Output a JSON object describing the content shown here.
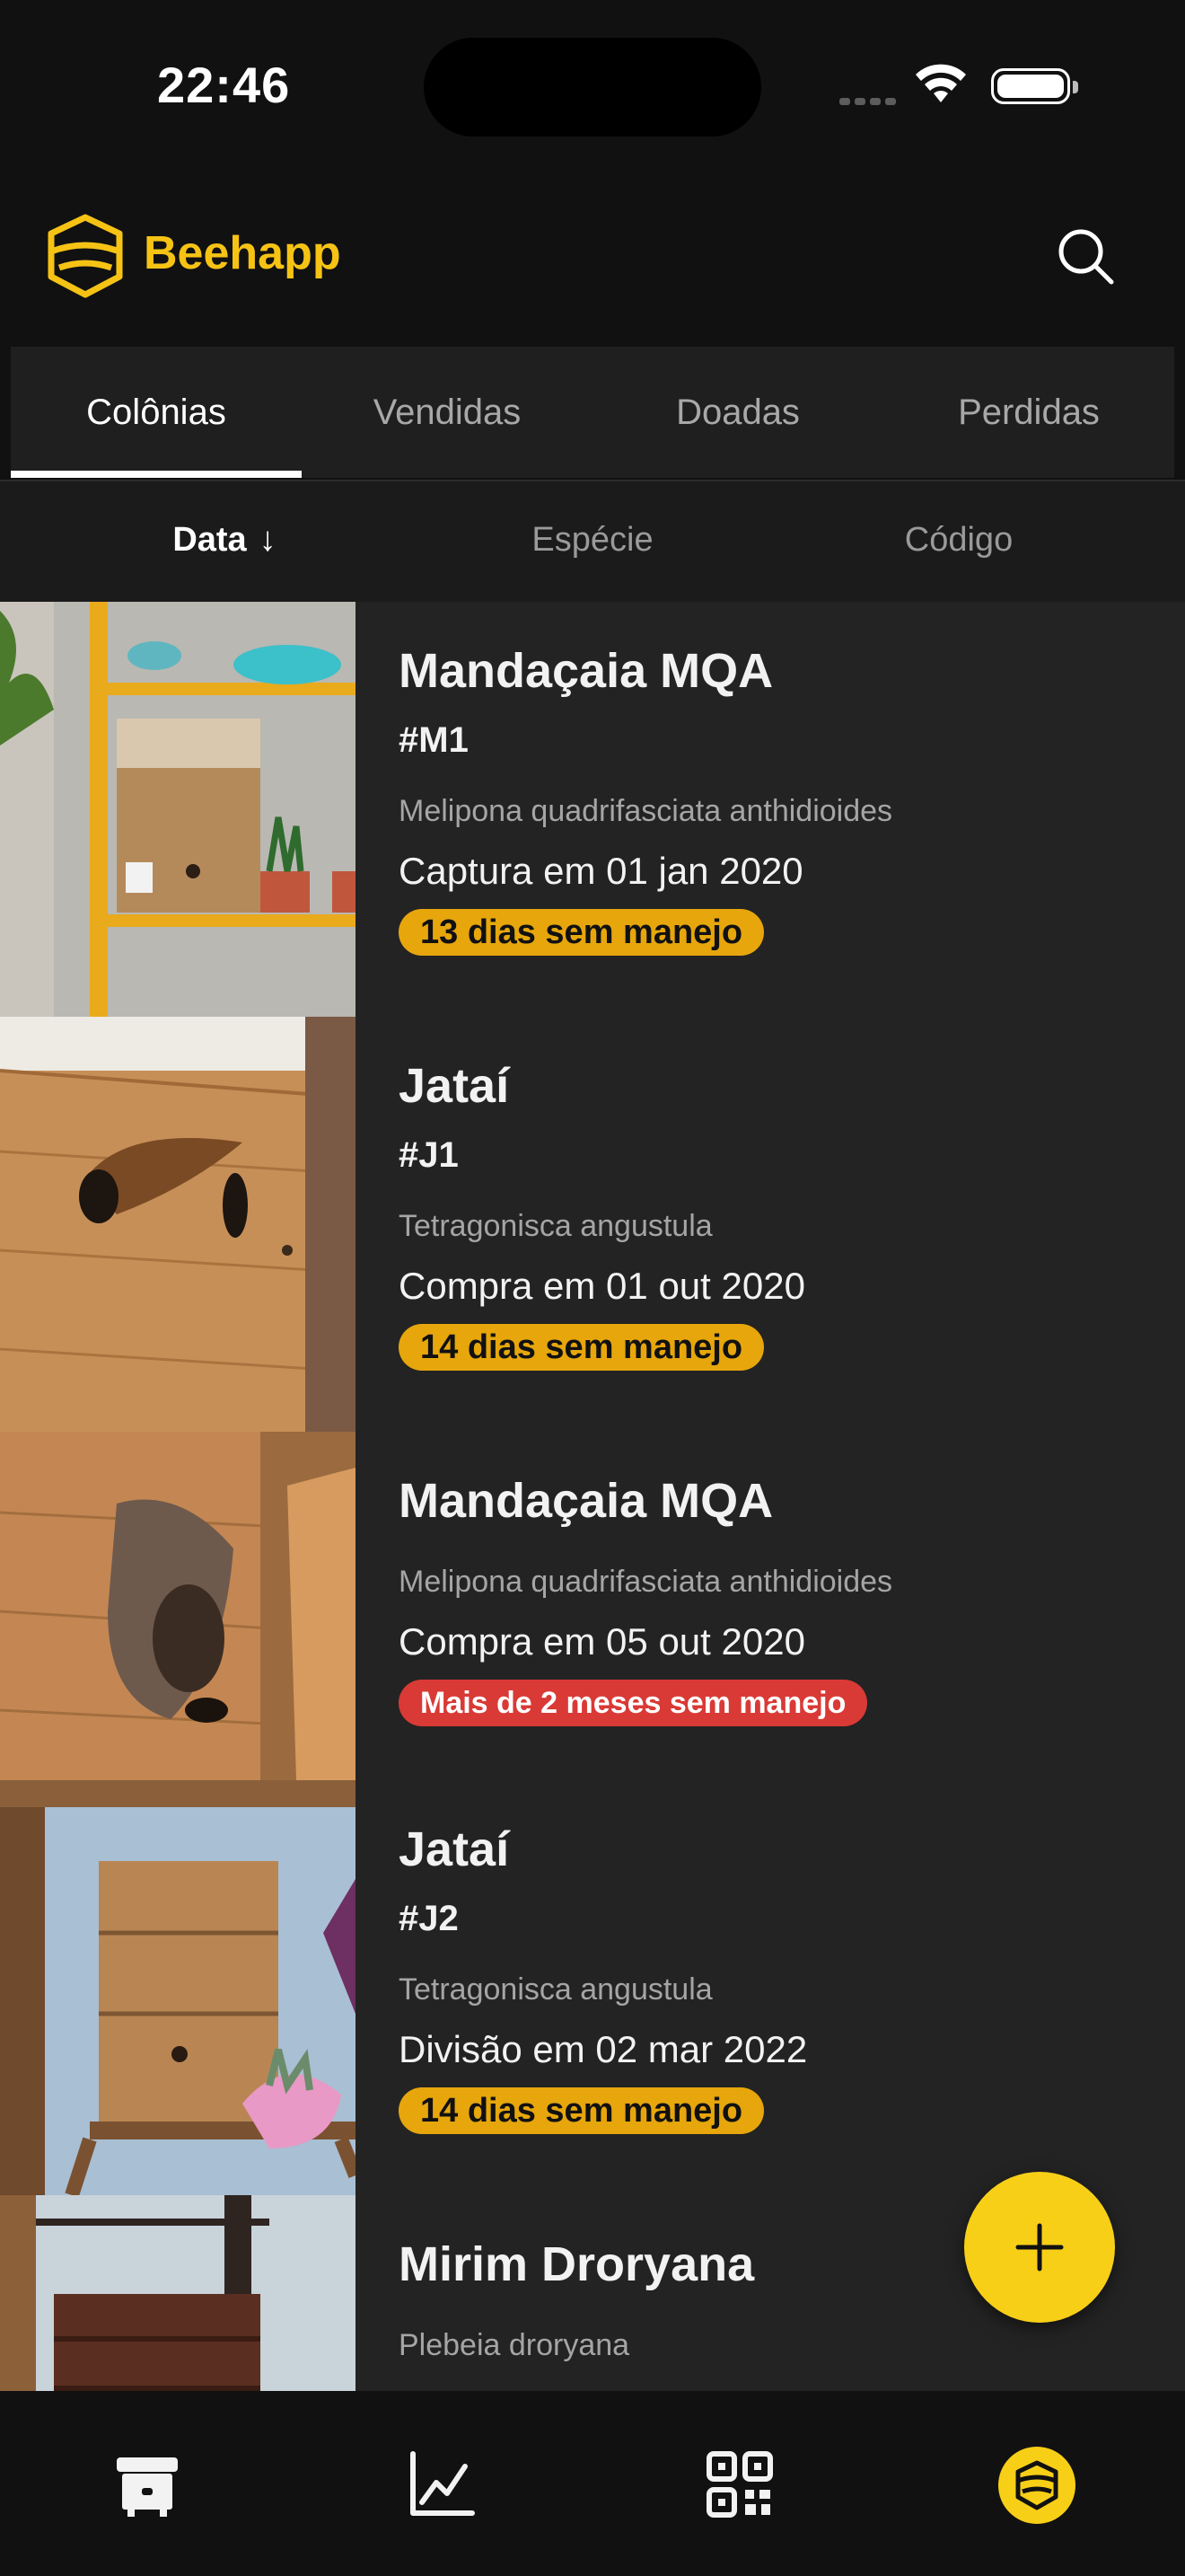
{
  "status_bar": {
    "time": "22:46"
  },
  "header": {
    "brand": "Beehapp",
    "search_icon": "search-icon"
  },
  "tabs": [
    {
      "label": "Colônias",
      "active": true
    },
    {
      "label": "Vendidas",
      "active": false
    },
    {
      "label": "Doadas",
      "active": false
    },
    {
      "label": "Perdidas",
      "active": false
    }
  ],
  "sort": {
    "options": [
      {
        "label": "Data",
        "active": true,
        "direction": "↓"
      },
      {
        "label": "Espécie",
        "active": false
      },
      {
        "label": "Código",
        "active": false
      }
    ]
  },
  "colonies": [
    {
      "name": "Mandaçaia MQA",
      "code": "#M1",
      "species": "Melipona quadrifasciata anthidioides",
      "origin": "Captura em 01 jan 2020",
      "status": "13 dias sem manejo",
      "status_level": "warn"
    },
    {
      "name": "Jataí",
      "code": "#J1",
      "species": "Tetragonisca angustula",
      "origin": "Compra em 01 out 2020",
      "status": "14 dias sem manejo",
      "status_level": "warn"
    },
    {
      "name": "Mandaçaia MQA",
      "code": "",
      "species": "Melipona quadrifasciata anthidioides",
      "origin": "Compra em 05 out 2020",
      "status": "Mais de 2 meses sem manejo",
      "status_level": "danger"
    },
    {
      "name": "Jataí",
      "code": "#J2",
      "species": "Tetragonisca angustula",
      "origin": "Divisão em 02 mar 2022",
      "status": "14 dias sem manejo",
      "status_level": "warn"
    },
    {
      "name": "Mirim Droryana",
      "code": "",
      "species": "Plebeia droryana",
      "origin": "",
      "status": "",
      "status_level": ""
    }
  ],
  "fab": {
    "icon": "plus-icon"
  },
  "bottom_nav": [
    {
      "icon": "hive-box-icon",
      "active": false
    },
    {
      "icon": "chart-icon",
      "active": false
    },
    {
      "icon": "qr-code-icon",
      "active": false
    },
    {
      "icon": "bee-logo-icon",
      "active": true
    }
  ],
  "colors": {
    "accent": "#f8cf17",
    "warn": "#e6a60c",
    "danger": "#d93a36",
    "background": "#111111",
    "card": "#232323"
  }
}
